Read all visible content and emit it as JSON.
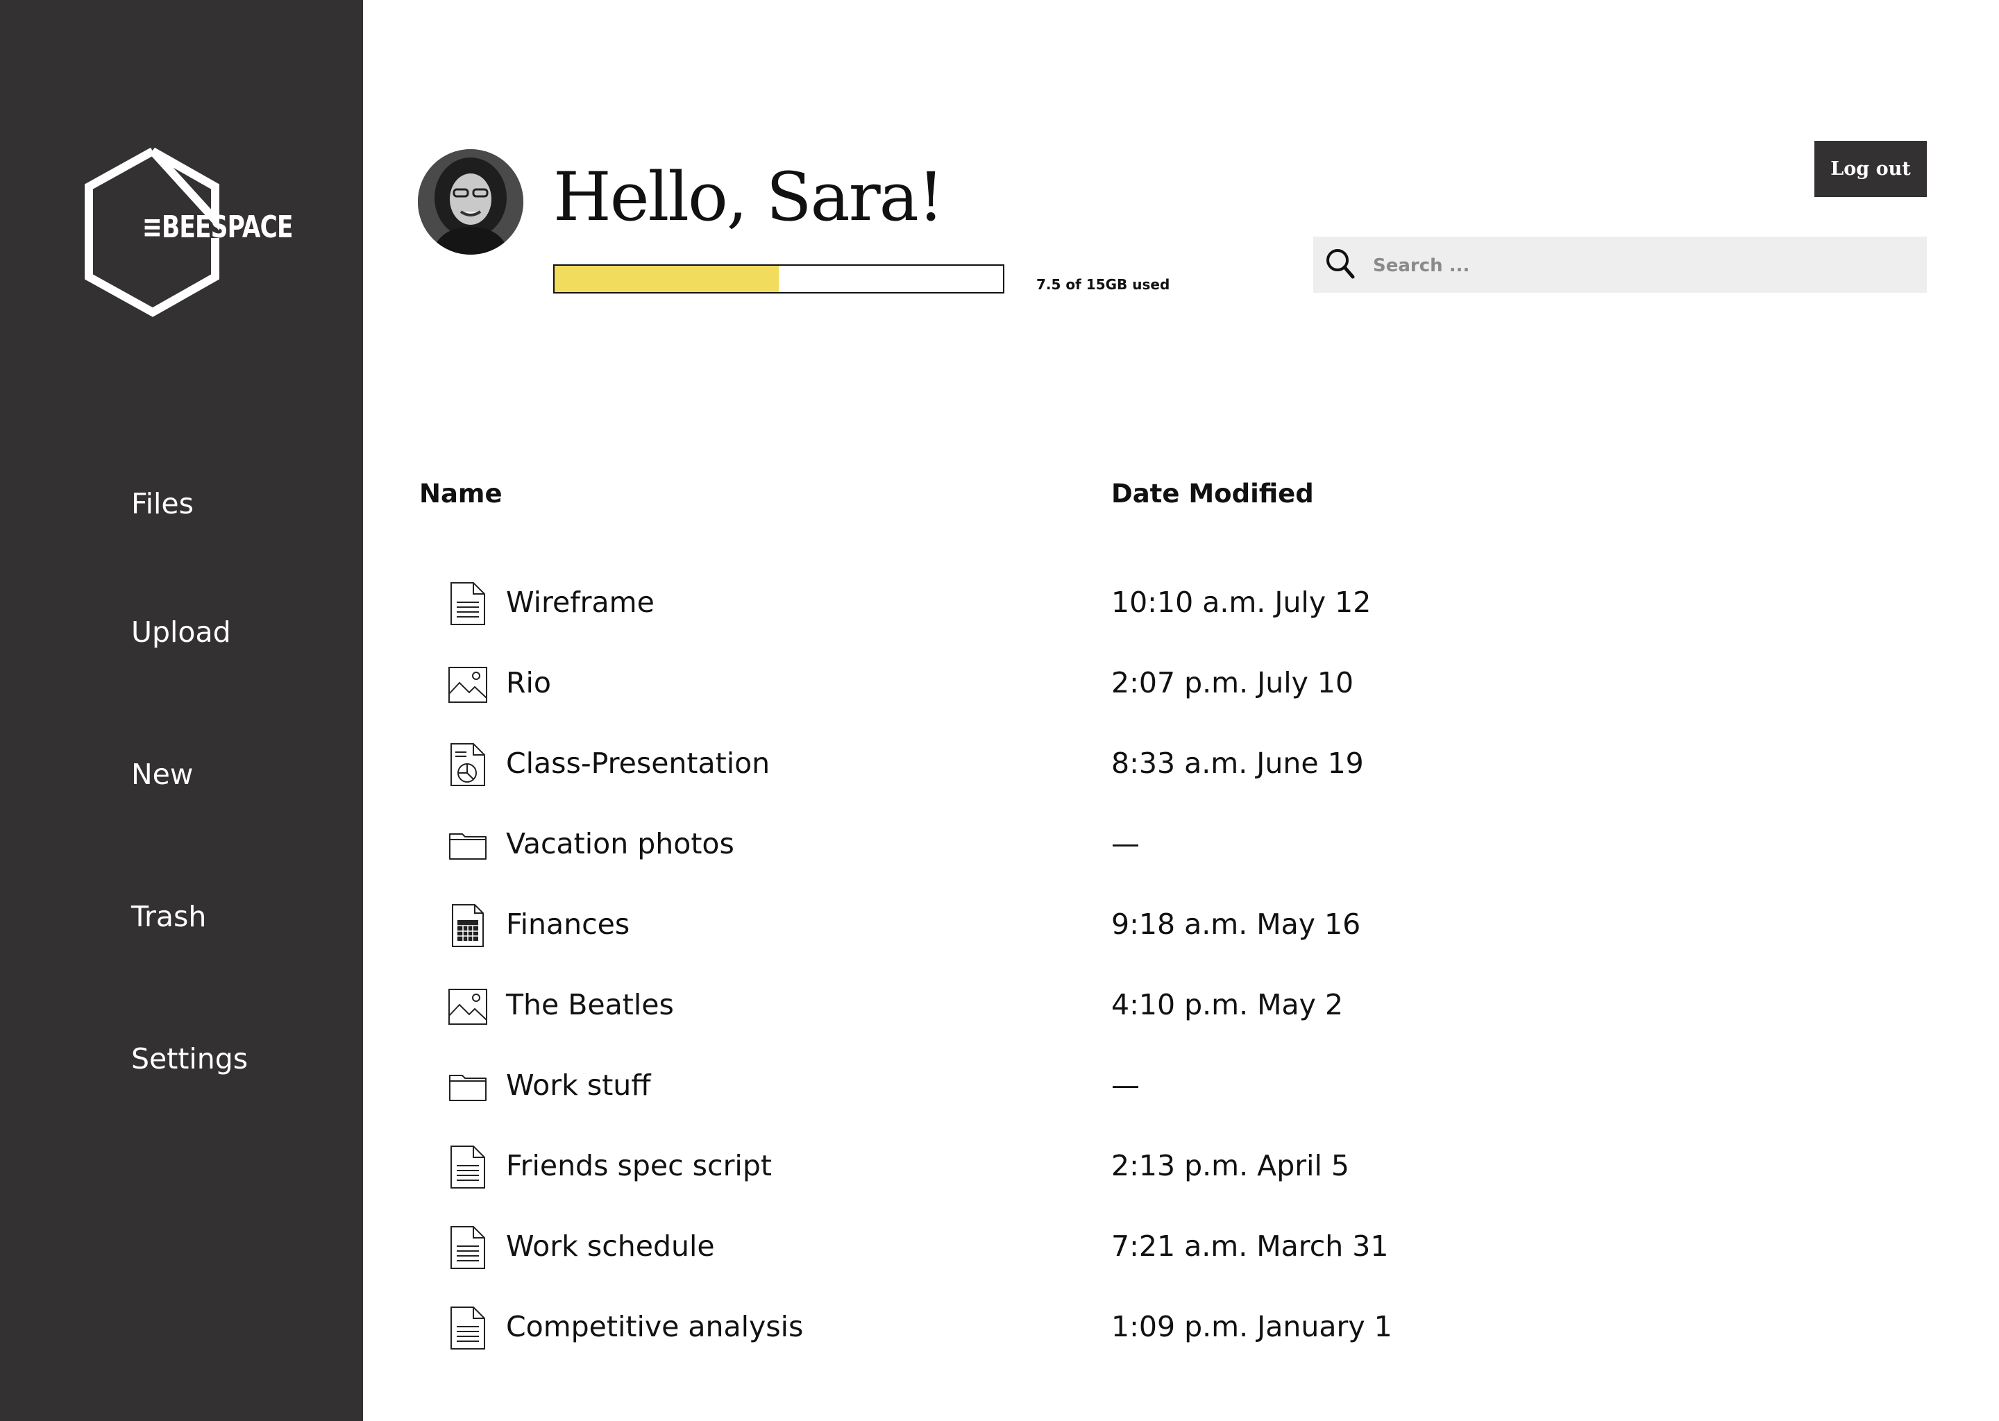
{
  "brand": {
    "name": "≡BEESPACE"
  },
  "sidebar": {
    "items": [
      {
        "label": "Files",
        "id": "files"
      },
      {
        "label": "Upload",
        "id": "upload"
      },
      {
        "label": "New",
        "id": "new"
      },
      {
        "label": "Trash",
        "id": "trash"
      },
      {
        "label": "Settings",
        "id": "settings"
      }
    ]
  },
  "header": {
    "greeting": "Hello, Sara!",
    "storage_text": "7.5 of 15GB used",
    "storage_fraction": 0.5,
    "storage_color": "#f2dc5d",
    "logout_label": "Log out",
    "search_placeholder": "Search ...",
    "search_value": ""
  },
  "table": {
    "columns": {
      "name": "Name",
      "date": "Date Modified"
    },
    "rows": [
      {
        "name": "Wireframe",
        "date": "10:10 a.m. July 12",
        "icon": "document-icon"
      },
      {
        "name": "Rio",
        "date": "2:07 p.m. July 10",
        "icon": "image-icon"
      },
      {
        "name": "Class-Presentation",
        "date": "8:33 a.m. June 19",
        "icon": "presentation-icon"
      },
      {
        "name": "Vacation photos",
        "date": "—",
        "icon": "folder-icon"
      },
      {
        "name": "Finances",
        "date": "9:18 a.m. May 16",
        "icon": "spreadsheet-icon"
      },
      {
        "name": "The Beatles",
        "date": "4:10 p.m. May 2",
        "icon": "image-icon"
      },
      {
        "name": "Work stuff",
        "date": "—",
        "icon": "folder-icon"
      },
      {
        "name": "Friends spec script",
        "date": "2:13 p.m. April 5",
        "icon": "document-icon"
      },
      {
        "name": "Work schedule",
        "date": "7:21 a.m. March 31",
        "icon": "document-icon"
      },
      {
        "name": "Competitive analysis",
        "date": "1:09 p.m. January 1",
        "icon": "document-icon"
      }
    ]
  },
  "colors": {
    "sidebar_bg": "#333132",
    "accent": "#f2dc5d",
    "search_bg": "#eeeeee"
  }
}
